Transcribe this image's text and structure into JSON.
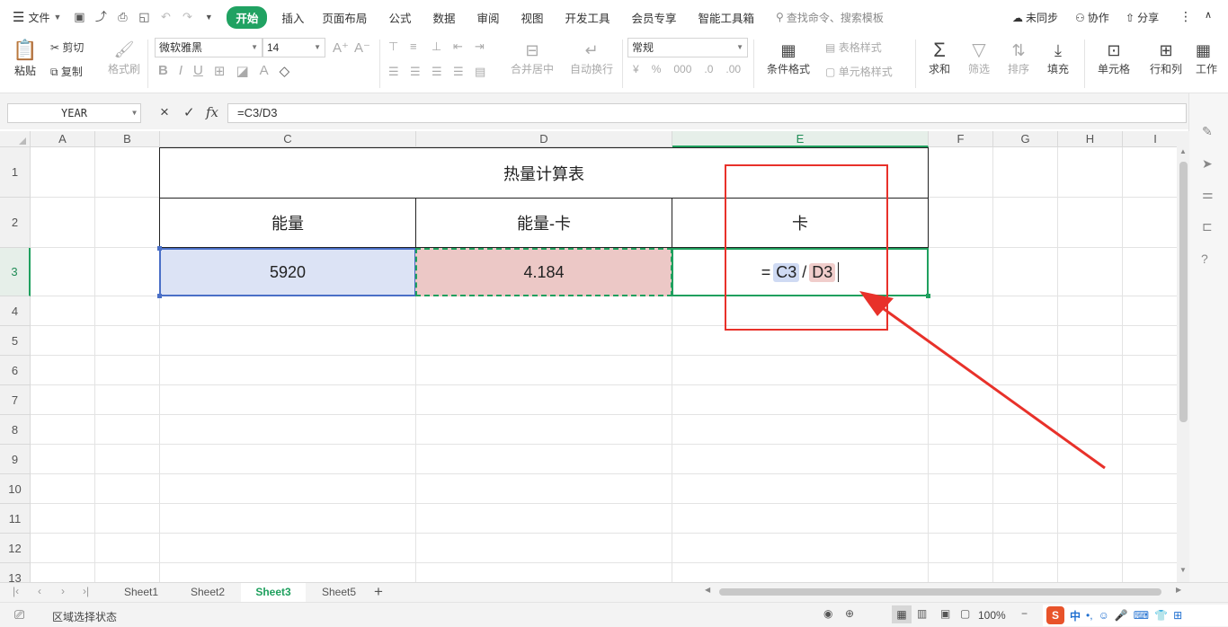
{
  "menu": {
    "file": "文件",
    "tabs": [
      "开始",
      "插入",
      "页面布局",
      "公式",
      "数据",
      "审阅",
      "视图",
      "开发工具",
      "会员专享",
      "智能工具箱"
    ],
    "search_placeholder": "查找命令、搜索模板",
    "sync": "未同步",
    "collab": "协作",
    "share": "分享"
  },
  "ribbon": {
    "paste": "粘贴",
    "cut": "剪切",
    "copy": "复制",
    "format_painter": "格式刷",
    "font_name": "微软雅黑",
    "font_size": "14",
    "merge_center": "合并居中",
    "wrap_text": "自动换行",
    "number_format": "常规",
    "conditional_format": "条件格式",
    "table_style": "表格样式",
    "cell_style": "单元格样式",
    "sum": "求和",
    "filter": "筛选",
    "sort": "排序",
    "fill": "填充",
    "cell": "单元格",
    "row_col": "行和列",
    "worksheet": "工作"
  },
  "formula_bar": {
    "name_box": "YEAR",
    "cancel": "×",
    "enter": "✓",
    "fx": "fx",
    "formula": "=C3/D3"
  },
  "columns": [
    "A",
    "B",
    "C",
    "D",
    "E",
    "F",
    "G",
    "H",
    "I"
  ],
  "rows": [
    "1",
    "2",
    "3",
    "4",
    "5",
    "6",
    "7",
    "8",
    "9",
    "10",
    "11",
    "12",
    "13"
  ],
  "table": {
    "title": "热量计算表",
    "headers": [
      "能量",
      "能量-卡",
      "卡"
    ],
    "values": [
      "5920",
      "4.184"
    ],
    "edit": {
      "eq": "=",
      "ref1": "C3",
      "div": "/",
      "ref2": "D3"
    }
  },
  "sheets": [
    "Sheet1",
    "Sheet2",
    "Sheet3",
    "Sheet5"
  ],
  "active_sheet": "Sheet3",
  "status": {
    "mode": "区域选择状态",
    "zoom": "100%"
  },
  "colors": {
    "accent": "#20a262",
    "annotation": "#e8312a",
    "ref1_fill": "#dce3f5",
    "ref2_fill": "#ecc8c6"
  }
}
